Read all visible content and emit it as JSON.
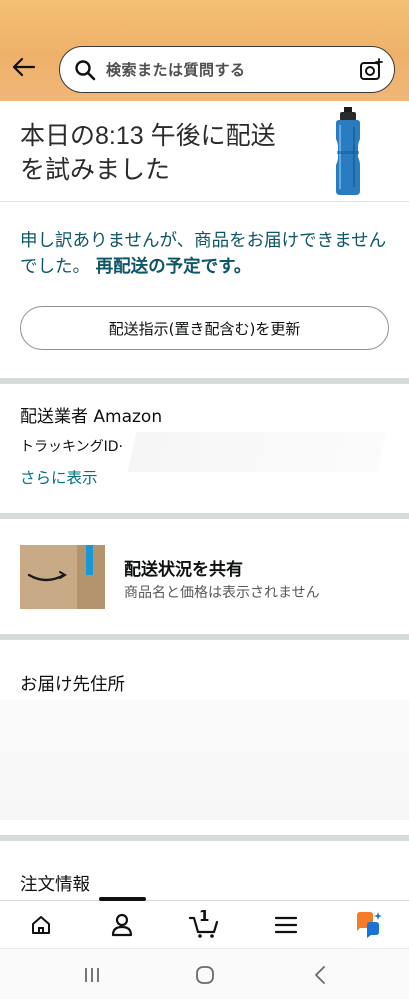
{
  "search": {
    "placeholder": "検索または質問する"
  },
  "delivery": {
    "title": "本日の8:13 午後に配送を試みました"
  },
  "notice": {
    "message": "申し訳ありませんが、商品をお届けできませんでした。",
    "emphasis": "再配送の予定です。"
  },
  "actions": {
    "update_instructions": "配送指示(置き配含む)を更新"
  },
  "carrier": {
    "label": "配送業者 Amazon",
    "tracking_label": "トラッキングID·",
    "show_more": "さらに表示"
  },
  "share": {
    "title": "配送状況を共有",
    "subtitle": "商品名と価格は表示されません"
  },
  "address": {
    "label": "お届け先住所"
  },
  "order": {
    "label": "注文情報"
  },
  "nav": {
    "cart_count": "1"
  },
  "colors": {
    "header": "#f4c073",
    "accent_teal": "#0e5667",
    "link": "#007185",
    "brand_blue": "#1a98d5"
  },
  "icons": [
    "back-arrow-icon",
    "search-icon",
    "camera-icon",
    "home-icon",
    "account-icon",
    "cart-icon",
    "menu-icon",
    "assistant-icon",
    "recent-apps-icon",
    "home-circle-icon",
    "back-chevron-icon"
  ]
}
